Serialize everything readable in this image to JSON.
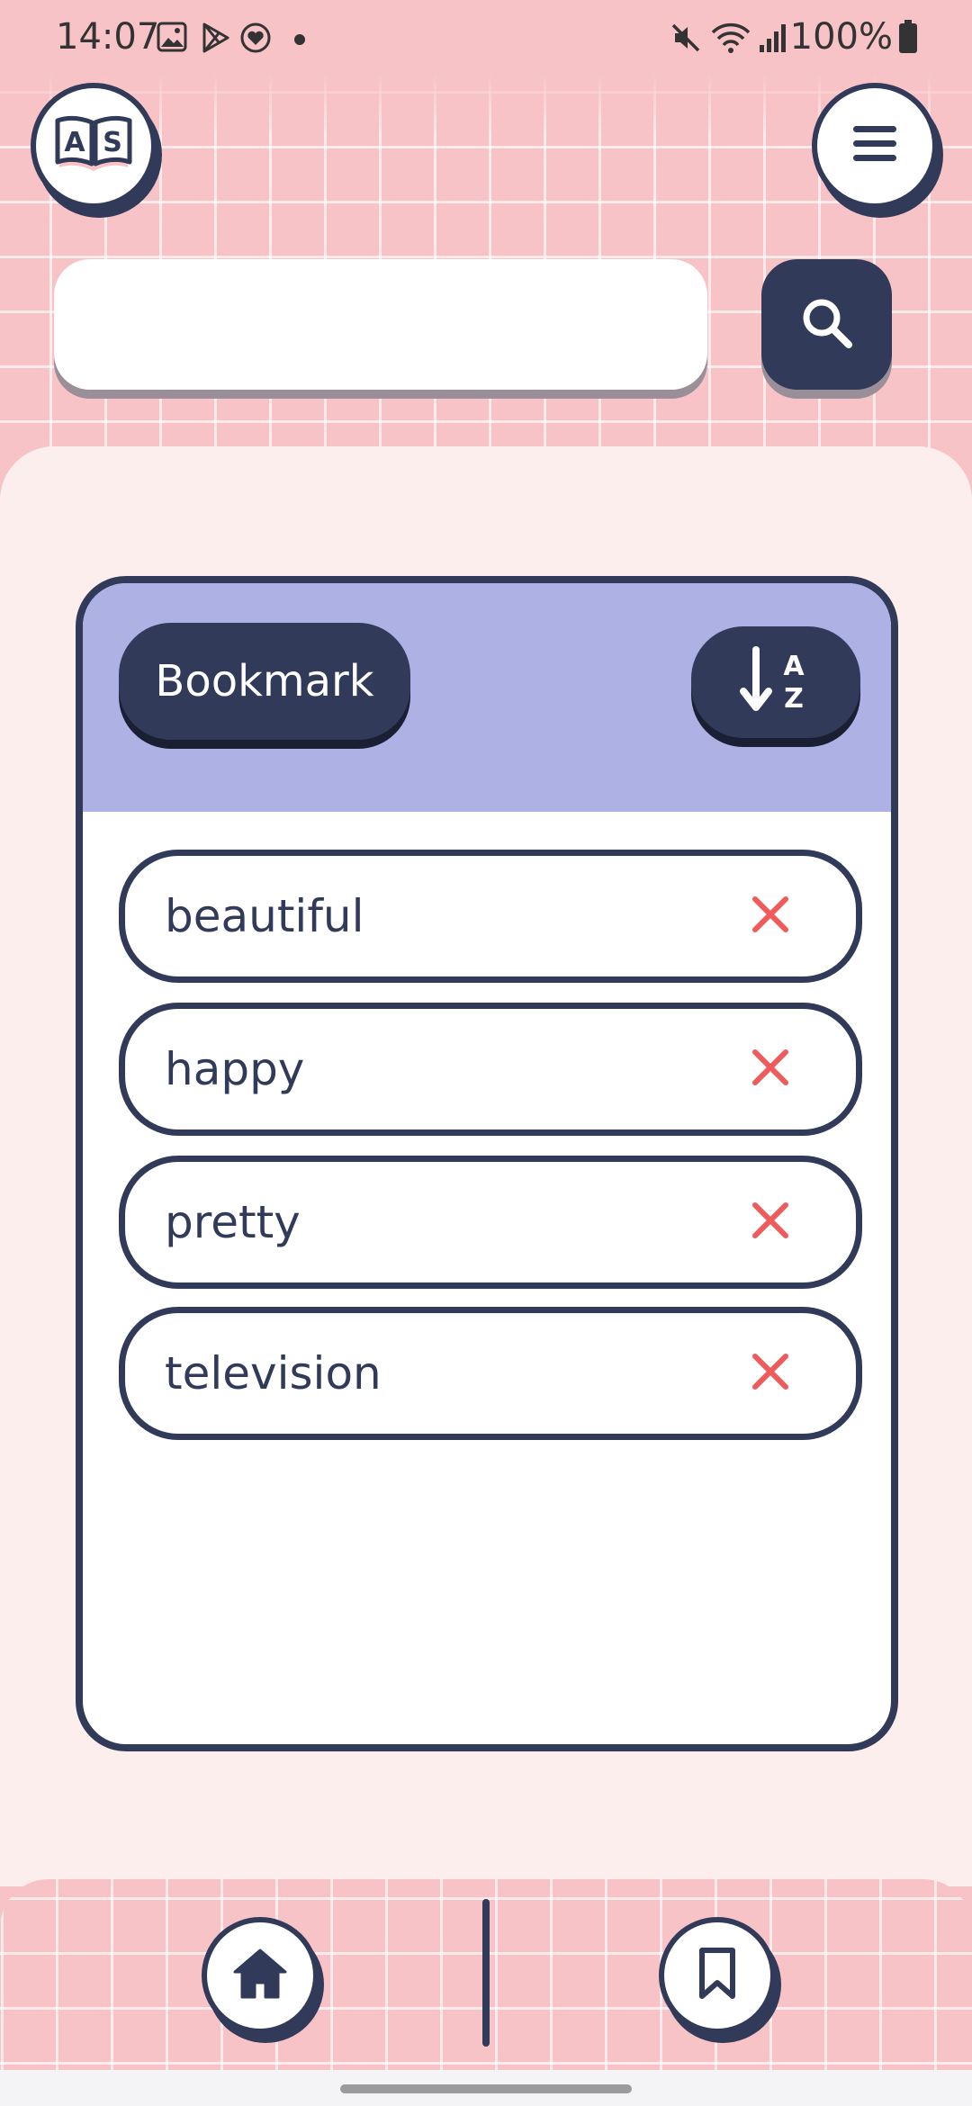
{
  "status_bar": {
    "time": "14:07",
    "battery": "100%",
    "icons": [
      "gallery-icon",
      "play-store-icon",
      "heart-badge-icon",
      "dot-icon",
      "mute-icon",
      "wifi-icon",
      "signal-icon",
      "battery-icon"
    ]
  },
  "header": {
    "logo_icon": "open-book-as-icon",
    "logo_letters": [
      "A",
      "S"
    ],
    "menu_icon": "hamburger-icon"
  },
  "search": {
    "value": "",
    "placeholder": "",
    "button_icon": "search-icon"
  },
  "bookmark_panel": {
    "title": "Bookmark",
    "sort_icon": "sort-alpha-down-icon",
    "sort_letters": [
      "A",
      "Z"
    ],
    "items": [
      {
        "word": "beautiful",
        "remove_icon": "close-icon"
      },
      {
        "word": "happy",
        "remove_icon": "close-icon"
      },
      {
        "word": "pretty",
        "remove_icon": "close-icon"
      },
      {
        "word": "television",
        "remove_icon": "close-icon"
      }
    ]
  },
  "bottom_nav": {
    "home_icon": "home-icon",
    "bookmark_icon": "bookmark-icon"
  },
  "colors": {
    "background_pink": "#f8c3c6",
    "panel_bg": "#fdeeee",
    "navy": "#313a58",
    "header_lavender": "#adb1e3",
    "remove_red": "#ef5b5b"
  }
}
